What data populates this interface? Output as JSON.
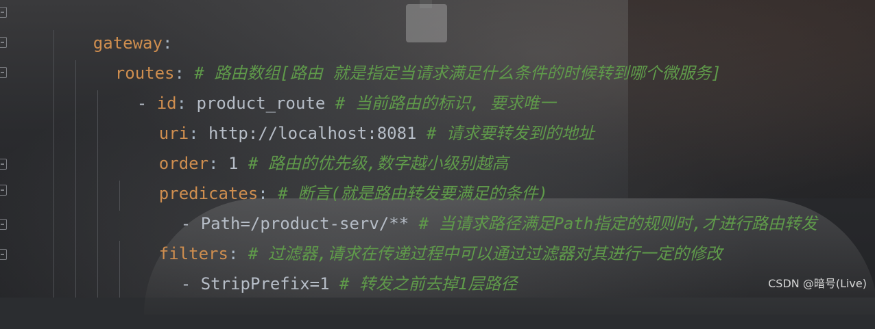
{
  "code_lines": [
    {
      "key": "gateway",
      "sep": ":",
      "value": "",
      "comment": ""
    },
    {
      "key": "routes",
      "sep": ":",
      "value": "",
      "comment": "# 路由数组[路由 就是指定当请求满足什么条件的时候转到哪个微服务]"
    },
    {
      "prefix": "- ",
      "key": "id",
      "sep": ":",
      "value": " product_route ",
      "comment": "# 当前路由的标识, 要求唯一"
    },
    {
      "key": "uri",
      "sep": ":",
      "value": " http://localhost:8081 ",
      "comment": "# 请求要转发到的地址"
    },
    {
      "key": "order",
      "sep": ":",
      "value": " 1 ",
      "comment": "# 路由的优先级,数字越小级别越高"
    },
    {
      "key": "predicates",
      "sep": ":",
      "value": " ",
      "comment": "# 断言(就是路由转发要满足的条件)"
    },
    {
      "prefix": "- ",
      "key": "",
      "sep": "",
      "value": "Path=/product-serv/** ",
      "comment": "# 当请求路径满足Path指定的规则时,才进行路由转发"
    },
    {
      "key": "filters",
      "sep": ":",
      "value": " ",
      "comment": "# 过滤器,请求在传递过程中可以通过过滤器对其进行一定的修改"
    },
    {
      "prefix": "- ",
      "key": "",
      "sep": "",
      "value": "StripPrefix=1 ",
      "comment": "# 转发之前去掉1层路径"
    }
  ],
  "watermark": "CSDN @暗号(Live)",
  "colors": {
    "key": "#cf8e4f",
    "value": "#b6bdc7",
    "comment": "#5f9a4a"
  }
}
